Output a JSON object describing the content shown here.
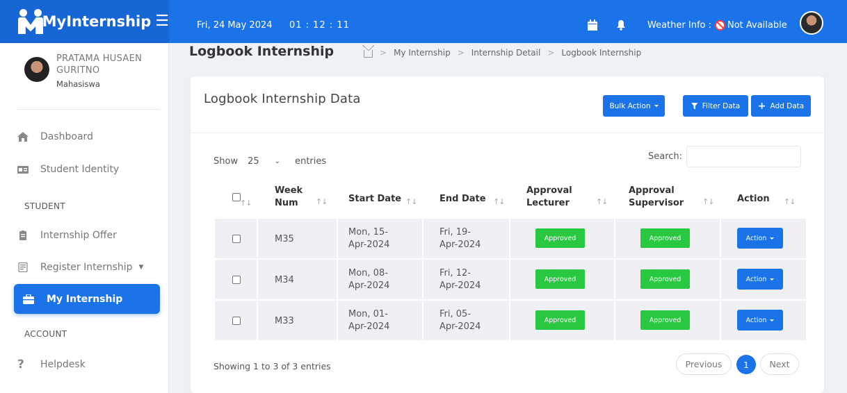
{
  "app": {
    "title": "MyInternship"
  },
  "topbar": {
    "date": "Fri, 24 May 2024",
    "time": "01 : 12 : 11",
    "weather_label": "Weather Info :",
    "weather_value": "Not Available"
  },
  "profile": {
    "name": "PRATAMA HUSAEN GURITNO",
    "role": "Mahasiswa"
  },
  "sidebar": {
    "dashboard": "Dashboard",
    "student_identity": "Student Identity",
    "section_student": "STUDENT",
    "internship_offer": "Internship Offer",
    "register_internship": "Register Internship",
    "my_internship": "My Internship",
    "section_account": "ACCOUNT",
    "helpdesk": "Helpdesk"
  },
  "page": {
    "title": "Logbook Internship",
    "breadcrumb": [
      "My Internship",
      "Internship Detail",
      "Logbook Internship"
    ]
  },
  "card": {
    "title": "Logbook Internship Data",
    "bulk_action": "Bulk Action",
    "filter_data": "Filter Data",
    "add_data": "Add Data"
  },
  "table_controls": {
    "show_label": "Show",
    "entries_value": "25",
    "entries_label": "entries",
    "search_label": "Search:"
  },
  "table": {
    "headers": {
      "week_num_1": "Week",
      "week_num_2": "Num",
      "start_date": "Start Date",
      "end_date": "End Date",
      "approval_lecturer_1": "Approval",
      "approval_lecturer_2": "Lecturer",
      "approval_supervisor_1": "Approval",
      "approval_supervisor_2": "Supervisor",
      "action": "Action"
    },
    "rows": [
      {
        "week": "M35",
        "start_1": "Mon, 15-",
        "start_2": "Apr-2024",
        "end_1": "Fri, 19-",
        "end_2": "Apr-2024",
        "lecturer": "Approved",
        "supervisor": "Approved",
        "action": "Action"
      },
      {
        "week": "M34",
        "start_1": "Mon, 08-",
        "start_2": "Apr-2024",
        "end_1": "Fri, 12-",
        "end_2": "Apr-2024",
        "lecturer": "Approved",
        "supervisor": "Approved",
        "action": "Action"
      },
      {
        "week": "M33",
        "start_1": "Mon, 01-",
        "start_2": "Apr-2024",
        "end_1": "Fri, 05-",
        "end_2": "Apr-2024",
        "lecturer": "Approved",
        "supervisor": "Approved",
        "action": "Action"
      }
    ]
  },
  "footer": {
    "info": "Showing 1 to 3 of 3 entries",
    "previous": "Previous",
    "page": "1",
    "next": "Next"
  },
  "colors": {
    "primary": "#1a73e8",
    "success": "#28c840",
    "alert": "#ff3b3b"
  },
  "icons": [
    "menu-icon",
    "calendar-icon",
    "bell-icon",
    "no-entry-icon",
    "home-icon",
    "dashboard-icon",
    "id-card-icon",
    "clipboard-icon",
    "form-icon",
    "briefcase-icon",
    "question-icon",
    "filter-icon",
    "plus-icon",
    "sort-icon",
    "chevron-down-icon"
  ]
}
